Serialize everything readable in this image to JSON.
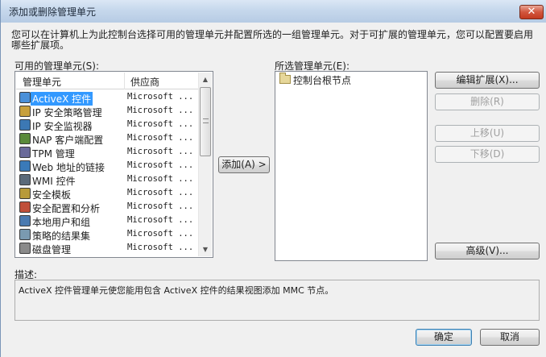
{
  "window": {
    "title": "添加或删除管理单元",
    "close_glyph": "✕"
  },
  "intro": "您可以在计算机上为此控制台选择可用的管理单元并配置所选的一组管理单元。对于可扩展的管理单元，您可以配置要启用哪些扩展项。",
  "available": {
    "label": "可用的管理单元(S):",
    "col_name": "管理单元",
    "col_vendor": "供应商",
    "items": [
      {
        "name": "ActiveX 控件",
        "vendor": "Microsoft ...",
        "icon": "activex-icon",
        "selected": true
      },
      {
        "name": "IP 安全策略管理",
        "vendor": "Microsoft ...",
        "icon": "security-policy-icon"
      },
      {
        "name": "IP 安全监视器",
        "vendor": "Microsoft ...",
        "icon": "security-monitor-icon"
      },
      {
        "name": "NAP 客户端配置",
        "vendor": "Microsoft ...",
        "icon": "nap-client-icon"
      },
      {
        "name": "TPM 管理",
        "vendor": "Microsoft ...",
        "icon": "tpm-icon"
      },
      {
        "name": "Web 地址的链接",
        "vendor": "Microsoft ...",
        "icon": "web-link-icon"
      },
      {
        "name": "WMI 控件",
        "vendor": "Microsoft ...",
        "icon": "wmi-icon"
      },
      {
        "name": "安全模板",
        "vendor": "Microsoft ...",
        "icon": "security-template-icon"
      },
      {
        "name": "安全配置和分析",
        "vendor": "Microsoft ...",
        "icon": "security-config-icon"
      },
      {
        "name": "本地用户和组",
        "vendor": "Microsoft ...",
        "icon": "users-groups-icon"
      },
      {
        "name": "策略的结果集",
        "vendor": "Microsoft ...",
        "icon": "policy-result-icon"
      },
      {
        "name": "磁盘管理",
        "vendor": "Microsoft ...",
        "icon": "disk-management-icon"
      }
    ]
  },
  "add_button": "添加(A) >",
  "selected": {
    "label": "所选管理单元(E):",
    "root": "控制台根节点"
  },
  "buttons": {
    "edit_extensions": "编辑扩展(X)...",
    "remove": "删除(R)",
    "move_up": "上移(U)",
    "move_down": "下移(D)",
    "advanced": "高级(V)...",
    "ok": "确定",
    "cancel": "取消"
  },
  "description": {
    "label": "描述:",
    "text": "ActiveX 控件管理单元使您能用包含 ActiveX 控件的结果视图添加 MMC 节点。"
  }
}
